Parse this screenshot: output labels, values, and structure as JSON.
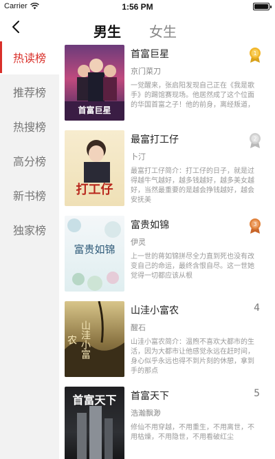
{
  "status": {
    "carrier": "Carrier",
    "time": "1:56 PM"
  },
  "nav": {
    "tab_male": "男生",
    "tab_female": "女生"
  },
  "sidebar": [
    {
      "label": "热读榜",
      "active": true
    },
    {
      "label": "推荐榜",
      "active": false
    },
    {
      "label": "热搜榜",
      "active": false
    },
    {
      "label": "高分榜",
      "active": false
    },
    {
      "label": "新书榜",
      "active": false
    },
    {
      "label": "独家榜",
      "active": false
    }
  ],
  "books": [
    {
      "title": "首富巨星",
      "author": "京门菜刀",
      "desc": "一觉醒来，张启阳发现自己正在《我是歌手》的踢馆赛现场。他居然成了这个位面的华国首富之子！他的前身，离经叛道，",
      "rank": "1",
      "rank_style": "gold-medal-icon",
      "cover_text": "首富巨星"
    },
    {
      "title": "最富打工仔",
      "author": "卜汀",
      "desc": "最富打工仔简介：打工仔的日子，就是过得越牛气越好，越多钱越好，越多美女越好，当然最重要的是越会挣钱越好，越会安抚美",
      "rank": "2",
      "rank_style": "silver-medal-icon",
      "cover_text": "打工仔"
    },
    {
      "title": "富贵如锦",
      "author": "伊灵",
      "desc": "上一世的蒋如锦拼尽全力直到死也没有改变自己的命运，最终含恨自尽。这一世她觉得一切都应该从根",
      "rank": "3",
      "rank_style": "bronze-medal-icon",
      "cover_text": "富贵如锦"
    },
    {
      "title": "山洼小富农",
      "author": "醒石",
      "desc": "山洼小富农简介：温煦不喜欢大都市的生活，因为大都市让他感觉永远在赶时间，身心似乎永远也得不到片刻的休憩，拿到手的那点",
      "rank": "4",
      "rank_style": "none",
      "cover_text": "山洼小富农"
    },
    {
      "title": "首富天下",
      "author": "浩瀚飘渺",
      "desc": "修仙不用穿越，不用重生，不用离世，不用枯燥，不用隐世，不用看破红尘",
      "rank": "5",
      "rank_style": "none",
      "cover_text": "首富天下"
    }
  ]
}
